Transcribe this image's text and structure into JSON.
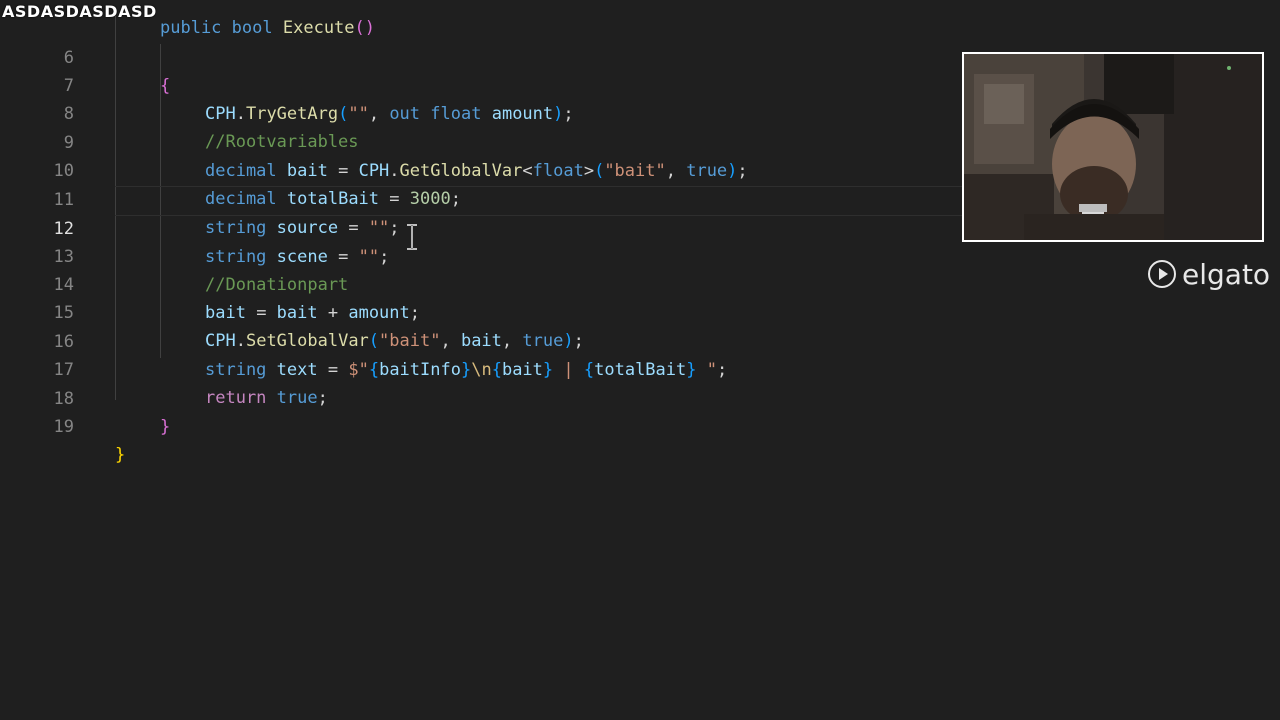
{
  "overlay": {
    "watermark_text": "ASDASDASDASD",
    "brand_name": "elgato"
  },
  "editor": {
    "header_partial": "public bool Execute()",
    "active_line": 12,
    "lines": [
      {
        "number": "6",
        "text": "{"
      },
      {
        "number": "7",
        "text": "CPH.TryGetArg(\"\", out float amount);"
      },
      {
        "number": "8",
        "text": "//Rootvariables"
      },
      {
        "number": "9",
        "text": "decimal bait = CPH.GetGlobalVar<float>(\"bait\", true);"
      },
      {
        "number": "10",
        "text": "decimal totalBait = 3000;"
      },
      {
        "number": "11",
        "text": "string source = \"\";"
      },
      {
        "number": "12",
        "text": "string scene = \"\";"
      },
      {
        "number": "13",
        "text": "//Donationpart"
      },
      {
        "number": "14",
        "text": "bait = bait + amount;"
      },
      {
        "number": "15",
        "text": "CPH.SetGlobalVar(\"bait\", bait, true);"
      },
      {
        "number": "16",
        "text": "string text = $\"{baitInfo}\\n{bait} | {totalBait} \";"
      },
      {
        "number": "17",
        "text": "return true;"
      },
      {
        "number": "18",
        "text": "}"
      },
      {
        "number": "19",
        "text": "}"
      }
    ]
  },
  "colors": {
    "background": "#1f1f1f",
    "keyword": "#569cd6",
    "string": "#ce9178",
    "comment": "#6a9955",
    "function": "#dcdcaa",
    "number": "#b5cea8"
  }
}
